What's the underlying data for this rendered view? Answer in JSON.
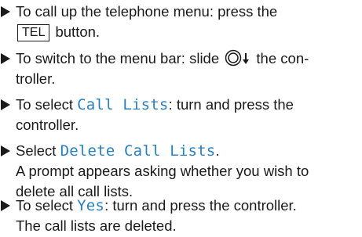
{
  "steps": [
    {
      "line1_pre": "To call up the telephone menu: press the",
      "key_label": "TEL",
      "line2_post": " button."
    },
    {
      "line1_pre": "To switch to the menu bar: slide ",
      "line1_post": " the con-",
      "line2": "troller.",
      "icon": "controller-slide-down-icon"
    },
    {
      "line1_pre": "To select ",
      "term": "Call Lists",
      "line1_post": ": turn and press the",
      "line2": "controller."
    },
    {
      "line1_pre": "Select ",
      "term": "Delete Call Lists",
      "line1_post": ".",
      "line2": "A prompt appears asking whether you wish to",
      "line3": "delete all call lists."
    },
    {
      "line1_pre": "To select ",
      "term": "Yes",
      "line1_post": ": turn and press the controller.",
      "line2": "The call lists are deleted."
    }
  ],
  "colors": {
    "text": "#1a1a1a",
    "menu_term": "#2a7fbf"
  },
  "icons": {
    "bullet": "arrow-bullet-icon"
  }
}
